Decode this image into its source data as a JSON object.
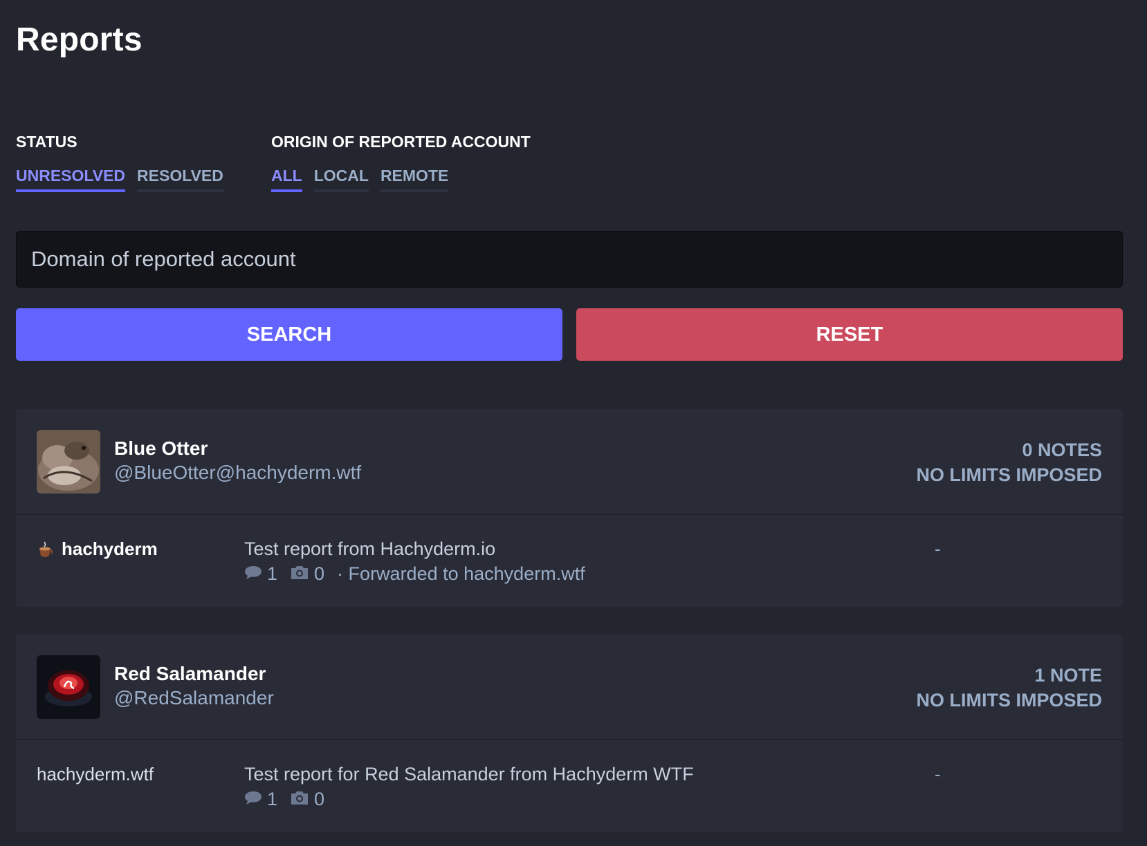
{
  "page": {
    "title": "Reports"
  },
  "filters": {
    "status": {
      "heading": "STATUS",
      "options": [
        "UNRESOLVED",
        "RESOLVED"
      ],
      "selected": "UNRESOLVED"
    },
    "origin": {
      "heading": "ORIGIN OF REPORTED ACCOUNT",
      "options": [
        "ALL",
        "LOCAL",
        "REMOTE"
      ],
      "selected": "ALL"
    }
  },
  "search": {
    "placeholder": "Domain of reported account",
    "value": "",
    "search_label": "SEARCH",
    "reset_label": "RESET"
  },
  "colors": {
    "accent": "#6364ff",
    "danger": "#cc4a5d",
    "background": "#23252f",
    "card": "#292b37"
  },
  "reports": [
    {
      "account": {
        "display_name": "Blue Otter",
        "acct": "@BlueOtter@hachyderm.wtf",
        "avatar_icon": "otter-avatar"
      },
      "notes": "0 NOTES",
      "limits": "NO LIMITS IMPOSED",
      "reporter": {
        "name": "hachyderm",
        "icon": "hachyderm-icon"
      },
      "comment": "Test report from Hachyderm.io",
      "statuses_count": "1",
      "media_count": "0",
      "forwarded": "· Forwarded to hachyderm.wtf",
      "assigned": "-"
    },
    {
      "account": {
        "display_name": "Red Salamander",
        "acct": "@RedSalamander",
        "avatar_icon": "salamander-avatar"
      },
      "notes": "1 NOTE",
      "limits": "NO LIMITS IMPOSED",
      "reporter": {
        "name": "hachyderm.wtf"
      },
      "comment": "Test report for Red Salamander from Hachyderm WTF",
      "statuses_count": "1",
      "media_count": "0",
      "assigned": "-"
    }
  ]
}
